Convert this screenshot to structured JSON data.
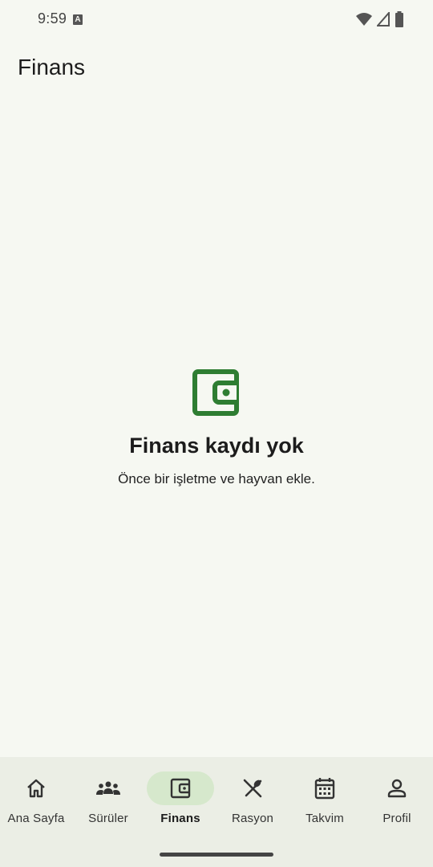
{
  "status_bar": {
    "time": "9:59",
    "notification_icon": "text-a-icon",
    "icons": [
      "wifi-icon",
      "signal-icon",
      "battery-icon"
    ]
  },
  "app_bar": {
    "title": "Finans"
  },
  "empty_state": {
    "icon": "wallet-icon",
    "icon_color": "#2e7d32",
    "title": "Finans kaydı yok",
    "subtitle": "Önce bir işletme ve hayvan ekle."
  },
  "bottom_nav": {
    "items": [
      {
        "label": "Ana Sayfa",
        "icon": "home-icon"
      },
      {
        "label": "Sürüler",
        "icon": "herd-icon"
      },
      {
        "label": "Finans",
        "icon": "wallet-icon",
        "active": true
      },
      {
        "label": "Rasyon",
        "icon": "feed-icon"
      },
      {
        "label": "Takvim",
        "icon": "calendar-icon"
      },
      {
        "label": "Profil",
        "icon": "person-icon"
      }
    ],
    "active_pill_color": "#d6e8cc"
  }
}
